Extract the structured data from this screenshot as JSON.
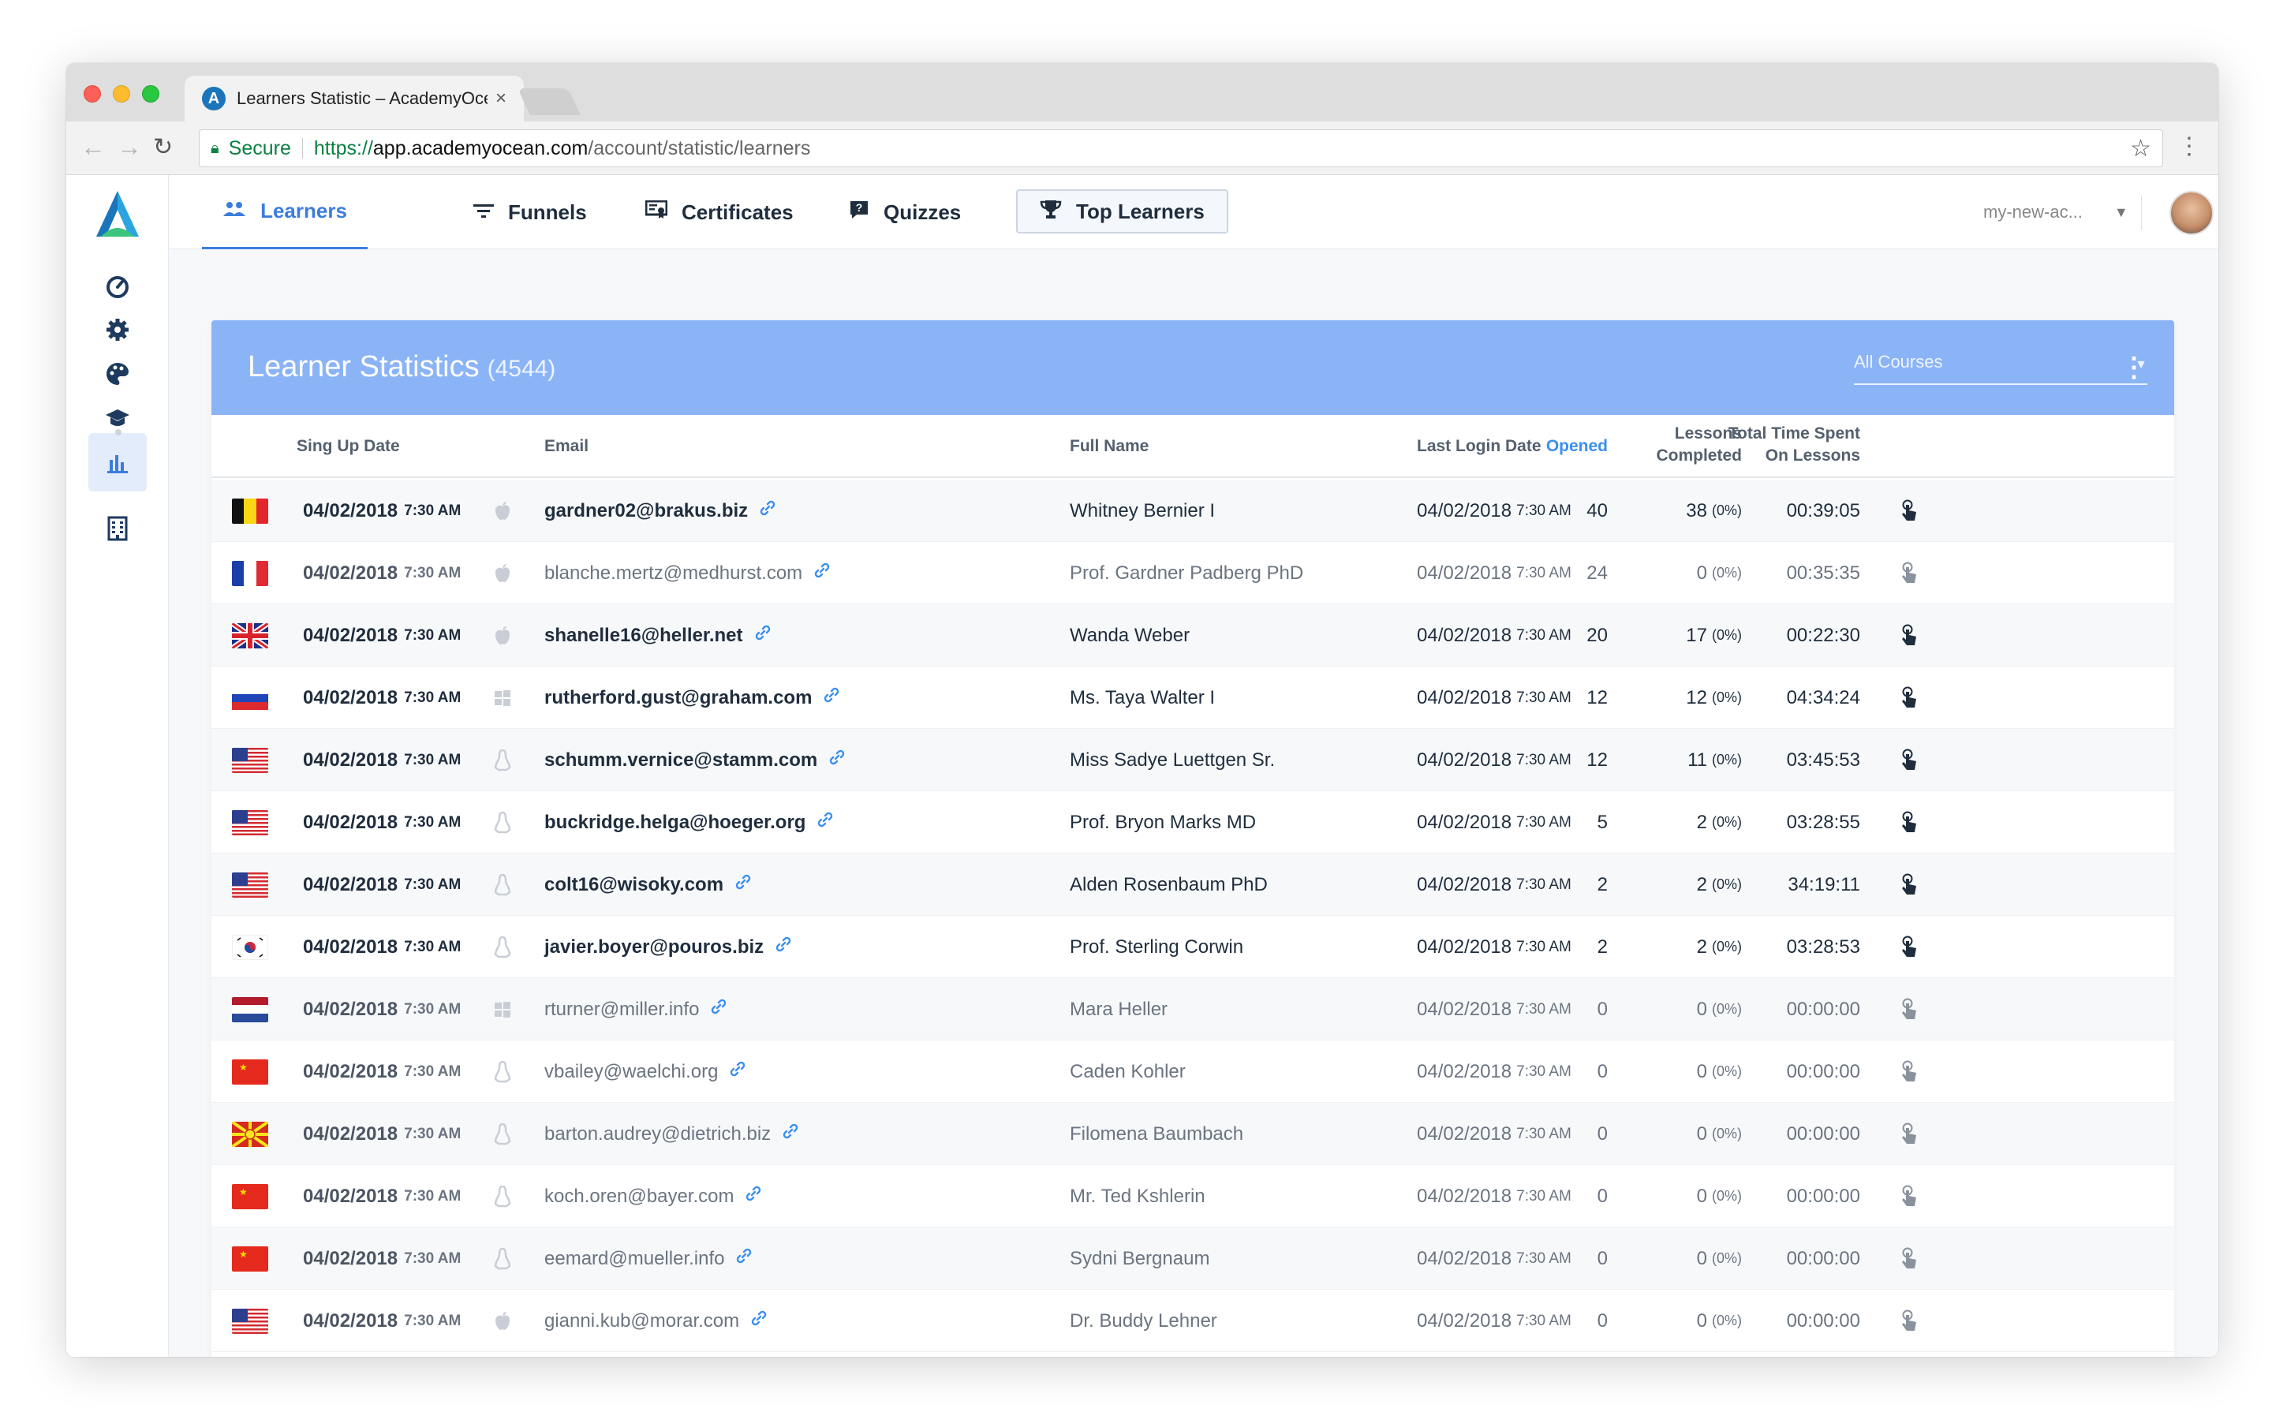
{
  "browser": {
    "tab_title": "Learners Statistic – AcademyOcean",
    "tab_favicon": "A",
    "tab_close": "×",
    "secure_label": "Secure",
    "url_scheme": "https://",
    "url_host": "app.academyocean.com",
    "url_path": "/account/statistic/learners"
  },
  "nav": {
    "tabs": [
      {
        "label": "Learners",
        "icon": "users-icon"
      },
      {
        "label": "Funnels",
        "icon": "filter-icon"
      },
      {
        "label": "Certificates",
        "icon": "certificate-icon"
      },
      {
        "label": "Quizzes",
        "icon": "quiz-icon"
      },
      {
        "label": "Top Learners",
        "icon": "trophy-icon"
      }
    ],
    "account": "my-new-ac..."
  },
  "card": {
    "title": "Learner Statistics",
    "count": "(4544)",
    "course_filter": "All Courses"
  },
  "columns": {
    "signup": "Sing Up Date",
    "email": "Email",
    "fullname": "Full Name",
    "lastlogin": "Last Login Date",
    "opened": "Opened",
    "lessons_1": "Lessons",
    "lessons_2": "Completed",
    "time_1": "Total Time Spent",
    "time_2": "On Lessons"
  },
  "rows": [
    {
      "flag": "be",
      "date": "04/02/2018",
      "time": "7:30 AM",
      "os": "apple",
      "email": "gardner02@brakus.biz",
      "name": "Whitney Bernier I",
      "login_date": "04/02/2018",
      "login_time": "7:30 AM",
      "opened": "40",
      "lessons": "38",
      "pct": "(0%)",
      "spent": "00:39:05",
      "bold": true
    },
    {
      "flag": "fr",
      "date": "04/02/2018",
      "time": "7:30 AM",
      "os": "apple",
      "email": "blanche.mertz@medhurst.com",
      "name": "Prof. Gardner Padberg PhD",
      "login_date": "04/02/2018",
      "login_time": "7:30 AM",
      "opened": "24",
      "lessons": "0",
      "pct": "(0%)",
      "spent": "00:35:35",
      "bold": false
    },
    {
      "flag": "gb",
      "date": "04/02/2018",
      "time": "7:30 AM",
      "os": "apple",
      "email": "shanelle16@heller.net",
      "name": "Wanda Weber",
      "login_date": "04/02/2018",
      "login_time": "7:30 AM",
      "opened": "20",
      "lessons": "17",
      "pct": "(0%)",
      "spent": "00:22:30",
      "bold": true
    },
    {
      "flag": "ru",
      "date": "04/02/2018",
      "time": "7:30 AM",
      "os": "windows",
      "email": "rutherford.gust@graham.com",
      "name": "Ms. Taya Walter I",
      "login_date": "04/02/2018",
      "login_time": "7:30 AM",
      "opened": "12",
      "lessons": "12",
      "pct": "(0%)",
      "spent": "04:34:24",
      "bold": true
    },
    {
      "flag": "us",
      "date": "04/02/2018",
      "time": "7:30 AM",
      "os": "linux",
      "email": "schumm.vernice@stamm.com",
      "name": "Miss Sadye Luettgen Sr.",
      "login_date": "04/02/2018",
      "login_time": "7:30 AM",
      "opened": "12",
      "lessons": "11",
      "pct": "(0%)",
      "spent": "03:45:53",
      "bold": true
    },
    {
      "flag": "us",
      "date": "04/02/2018",
      "time": "7:30 AM",
      "os": "linux",
      "email": "buckridge.helga@hoeger.org",
      "name": "Prof. Bryon Marks MD",
      "login_date": "04/02/2018",
      "login_time": "7:30 AM",
      "opened": "5",
      "lessons": "2",
      "pct": "(0%)",
      "spent": "03:28:55",
      "bold": true
    },
    {
      "flag": "us",
      "date": "04/02/2018",
      "time": "7:30 AM",
      "os": "linux",
      "email": "colt16@wisoky.com",
      "name": "Alden Rosenbaum PhD",
      "login_date": "04/02/2018",
      "login_time": "7:30 AM",
      "opened": "2",
      "lessons": "2",
      "pct": "(0%)",
      "spent": "34:19:11",
      "bold": true
    },
    {
      "flag": "kr",
      "date": "04/02/2018",
      "time": "7:30 AM",
      "os": "linux",
      "email": "javier.boyer@pouros.biz",
      "name": "Prof. Sterling Corwin",
      "login_date": "04/02/2018",
      "login_time": "7:30 AM",
      "opened": "2",
      "lessons": "2",
      "pct": "(0%)",
      "spent": "03:28:53",
      "bold": true
    },
    {
      "flag": "nl",
      "date": "04/02/2018",
      "time": "7:30 AM",
      "os": "windows",
      "email": "rturner@miller.info",
      "name": "Mara Heller",
      "login_date": "04/02/2018",
      "login_time": "7:30 AM",
      "opened": "0",
      "lessons": "0",
      "pct": "(0%)",
      "spent": "00:00:00",
      "bold": false
    },
    {
      "flag": "cn",
      "date": "04/02/2018",
      "time": "7:30 AM",
      "os": "linux",
      "email": "vbailey@waelchi.org",
      "name": "Caden Kohler",
      "login_date": "04/02/2018",
      "login_time": "7:30 AM",
      "opened": "0",
      "lessons": "0",
      "pct": "(0%)",
      "spent": "00:00:00",
      "bold": false
    },
    {
      "flag": "mk",
      "date": "04/02/2018",
      "time": "7:30 AM",
      "os": "linux",
      "email": "barton.audrey@dietrich.biz",
      "name": "Filomena Baumbach",
      "login_date": "04/02/2018",
      "login_time": "7:30 AM",
      "opened": "0",
      "lessons": "0",
      "pct": "(0%)",
      "spent": "00:00:00",
      "bold": false
    },
    {
      "flag": "cn",
      "date": "04/02/2018",
      "time": "7:30 AM",
      "os": "linux",
      "email": "koch.oren@bayer.com",
      "name": "Mr. Ted Kshlerin",
      "login_date": "04/02/2018",
      "login_time": "7:30 AM",
      "opened": "0",
      "lessons": "0",
      "pct": "(0%)",
      "spent": "00:00:00",
      "bold": false
    },
    {
      "flag": "cn",
      "date": "04/02/2018",
      "time": "7:30 AM",
      "os": "linux",
      "email": "eemard@mueller.info",
      "name": "Sydni Bergnaum",
      "login_date": "04/02/2018",
      "login_time": "7:30 AM",
      "opened": "0",
      "lessons": "0",
      "pct": "(0%)",
      "spent": "00:00:00",
      "bold": false
    },
    {
      "flag": "us",
      "date": "04/02/2018",
      "time": "7:30 AM",
      "os": "apple",
      "email": "gianni.kub@morar.com",
      "name": "Dr. Buddy Lehner",
      "login_date": "04/02/2018",
      "login_time": "7:30 AM",
      "opened": "0",
      "lessons": "0",
      "pct": "(0%)",
      "spent": "00:00:00",
      "bold": false
    }
  ],
  "colors": {
    "accent": "#3b7ddd",
    "header": "#8bb4f7",
    "opened": "#3b8ff0"
  }
}
